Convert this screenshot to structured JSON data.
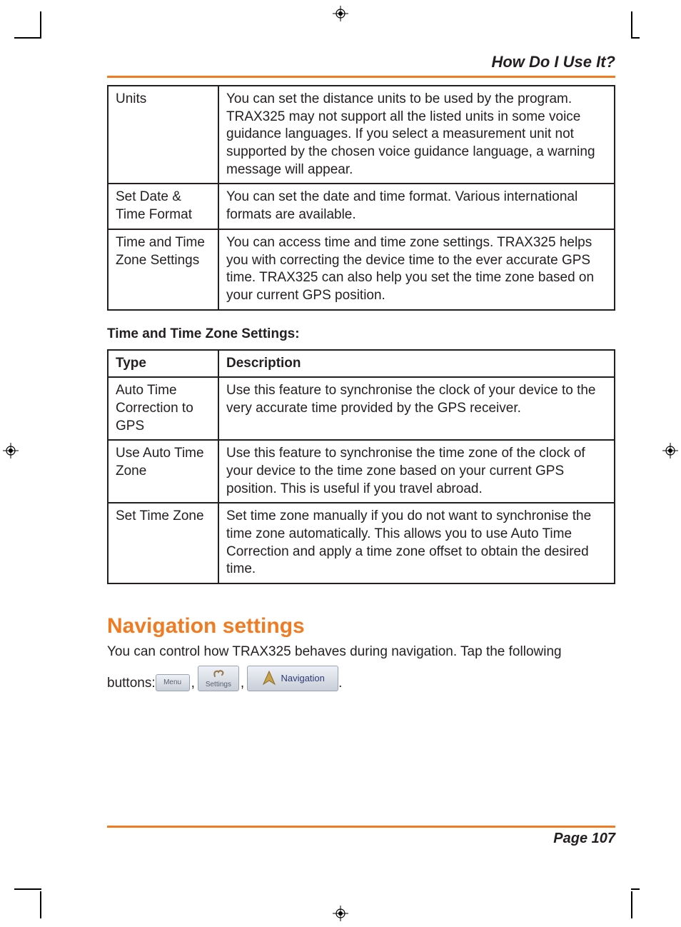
{
  "header": {
    "section_title": "How Do I Use It?"
  },
  "table1": {
    "rows": [
      {
        "label": "Units",
        "desc": "You can set the distance units to be used by the program. TRAX325 may not support all the listed units in some voice guidance languages. If you select a measurement unit not supported by the chosen voice guidance language, a warning message will appear."
      },
      {
        "label": "Set Date & Time Format",
        "desc": "You can set the date and time format. Various international formats are available."
      },
      {
        "label": "Time and Time Zone Settings",
        "desc": "You can access time and time zone settings. TRAX325 helps you with correcting the device time to the ever accurate GPS time. TRAX325 can also help you set the time zone based on your current GPS position."
      }
    ]
  },
  "subhead": "Time and Time Zone Settings:",
  "table2": {
    "head": {
      "col1": "Type",
      "col2": "Description"
    },
    "rows": [
      {
        "label": "Auto Time Correction to GPS",
        "desc": "Use this feature to synchronise the clock of your device to the very accurate time provided by the GPS receiver."
      },
      {
        "label": "Use Auto Time Zone",
        "desc": "Use this feature to synchronise the time zone of the clock of your device to the time zone based on your current GPS position. This is useful if you travel abroad."
      },
      {
        "label": "Set Time Zone",
        "desc": "Set time zone manually if you do not want to synchronise the time zone automatically. This allows you to use Auto Time Correction and apply a time zone offset to obtain the desired time."
      }
    ]
  },
  "nav_section": {
    "title": "Navigation settings",
    "intro_line1": "You can control how TRAX325 behaves during navigation. Tap the following",
    "intro_prefix": "buttons: ",
    "buttons": {
      "menu": "Menu",
      "settings": "Settings",
      "navigation": "Navigation"
    }
  },
  "footer": {
    "page": "Page 107"
  }
}
